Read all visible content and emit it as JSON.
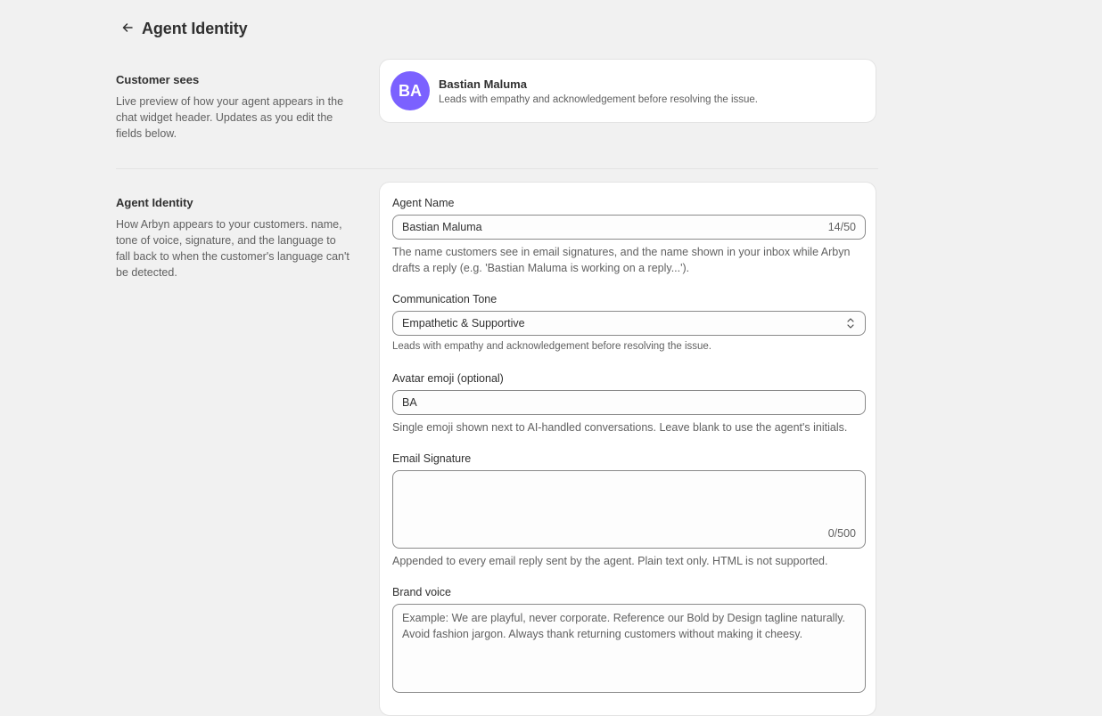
{
  "header": {
    "title": "Agent Identity"
  },
  "preview_section": {
    "heading": "Customer sees",
    "description": "Live preview of how your agent appears in the chat widget header. Updates as you edit the fields below.",
    "avatar_initials": "BA",
    "avatar_color": "#7b61ff",
    "agent_name": "Bastian Maluma",
    "tone_summary": "Leads with empathy and acknowledgement before resolving the issue."
  },
  "identity_section": {
    "heading": "Agent Identity",
    "description": "How Arbyn appears to your customers. name, tone of voice, signature, and the language to fall back to when the customer's language can't be detected."
  },
  "form": {
    "agent_name": {
      "label": "Agent Name",
      "value": "Bastian Maluma",
      "counter": "14/50",
      "help": "The name customers see in email signatures, and the name shown in your inbox while Arbyn drafts a reply (e.g. 'Bastian Maluma is working on a reply...')."
    },
    "communication_tone": {
      "label": "Communication Tone",
      "selected": "Empathetic & Supportive",
      "help": "Leads with empathy and acknowledgement before resolving the issue."
    },
    "avatar_emoji": {
      "label": "Avatar emoji (optional)",
      "value": "BA",
      "help": "Single emoji shown next to AI-handled conversations. Leave blank to use the agent's initials."
    },
    "email_signature": {
      "label": "Email Signature",
      "value": "",
      "counter": "0/500",
      "help": "Appended to every email reply sent by the agent. Plain text only. HTML is not supported."
    },
    "brand_voice": {
      "label": "Brand voice",
      "placeholder": "Example: We are playful, never corporate. Reference our Bold by Design tagline naturally. Avoid fashion jargon. Always thank returning customers without making it cheesy."
    }
  }
}
